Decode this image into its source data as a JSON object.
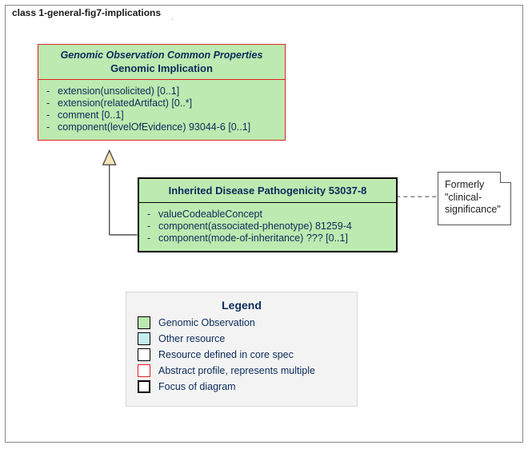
{
  "frame": {
    "title": "class 1-general-fig7-implications"
  },
  "abstractClass": {
    "supertitle": "Genomic Observation Common Properties",
    "title": "Genomic Implication",
    "attrs": [
      "extension(unsolicited) [0..1]",
      "extension(relatedArtifact) [0..*]",
      "comment [0..1]",
      "component(levelOfEvidence) 93044-6 [0..1]"
    ]
  },
  "focusClass": {
    "title": "Inherited Disease Pathogenicity 53037-8",
    "attrs": [
      "valueCodeableConcept",
      "component(associated-phenotype) 81259-4",
      "component(mode-of-inheritance) ??? [0..1]"
    ]
  },
  "note": {
    "line1": "Formerly",
    "line2": "\"clinical-",
    "line3": "significance\""
  },
  "legend": {
    "title": "Legend",
    "items": [
      {
        "label": "Genomic Observation",
        "swatch": "green"
      },
      {
        "label": "Other resource",
        "swatch": "cyan"
      },
      {
        "label": "Resource defined in core spec",
        "swatch": "core"
      },
      {
        "label": "Abstract profile, represents multiple",
        "swatch": "abstract"
      },
      {
        "label": "Focus of diagram",
        "swatch": "focus"
      }
    ]
  }
}
